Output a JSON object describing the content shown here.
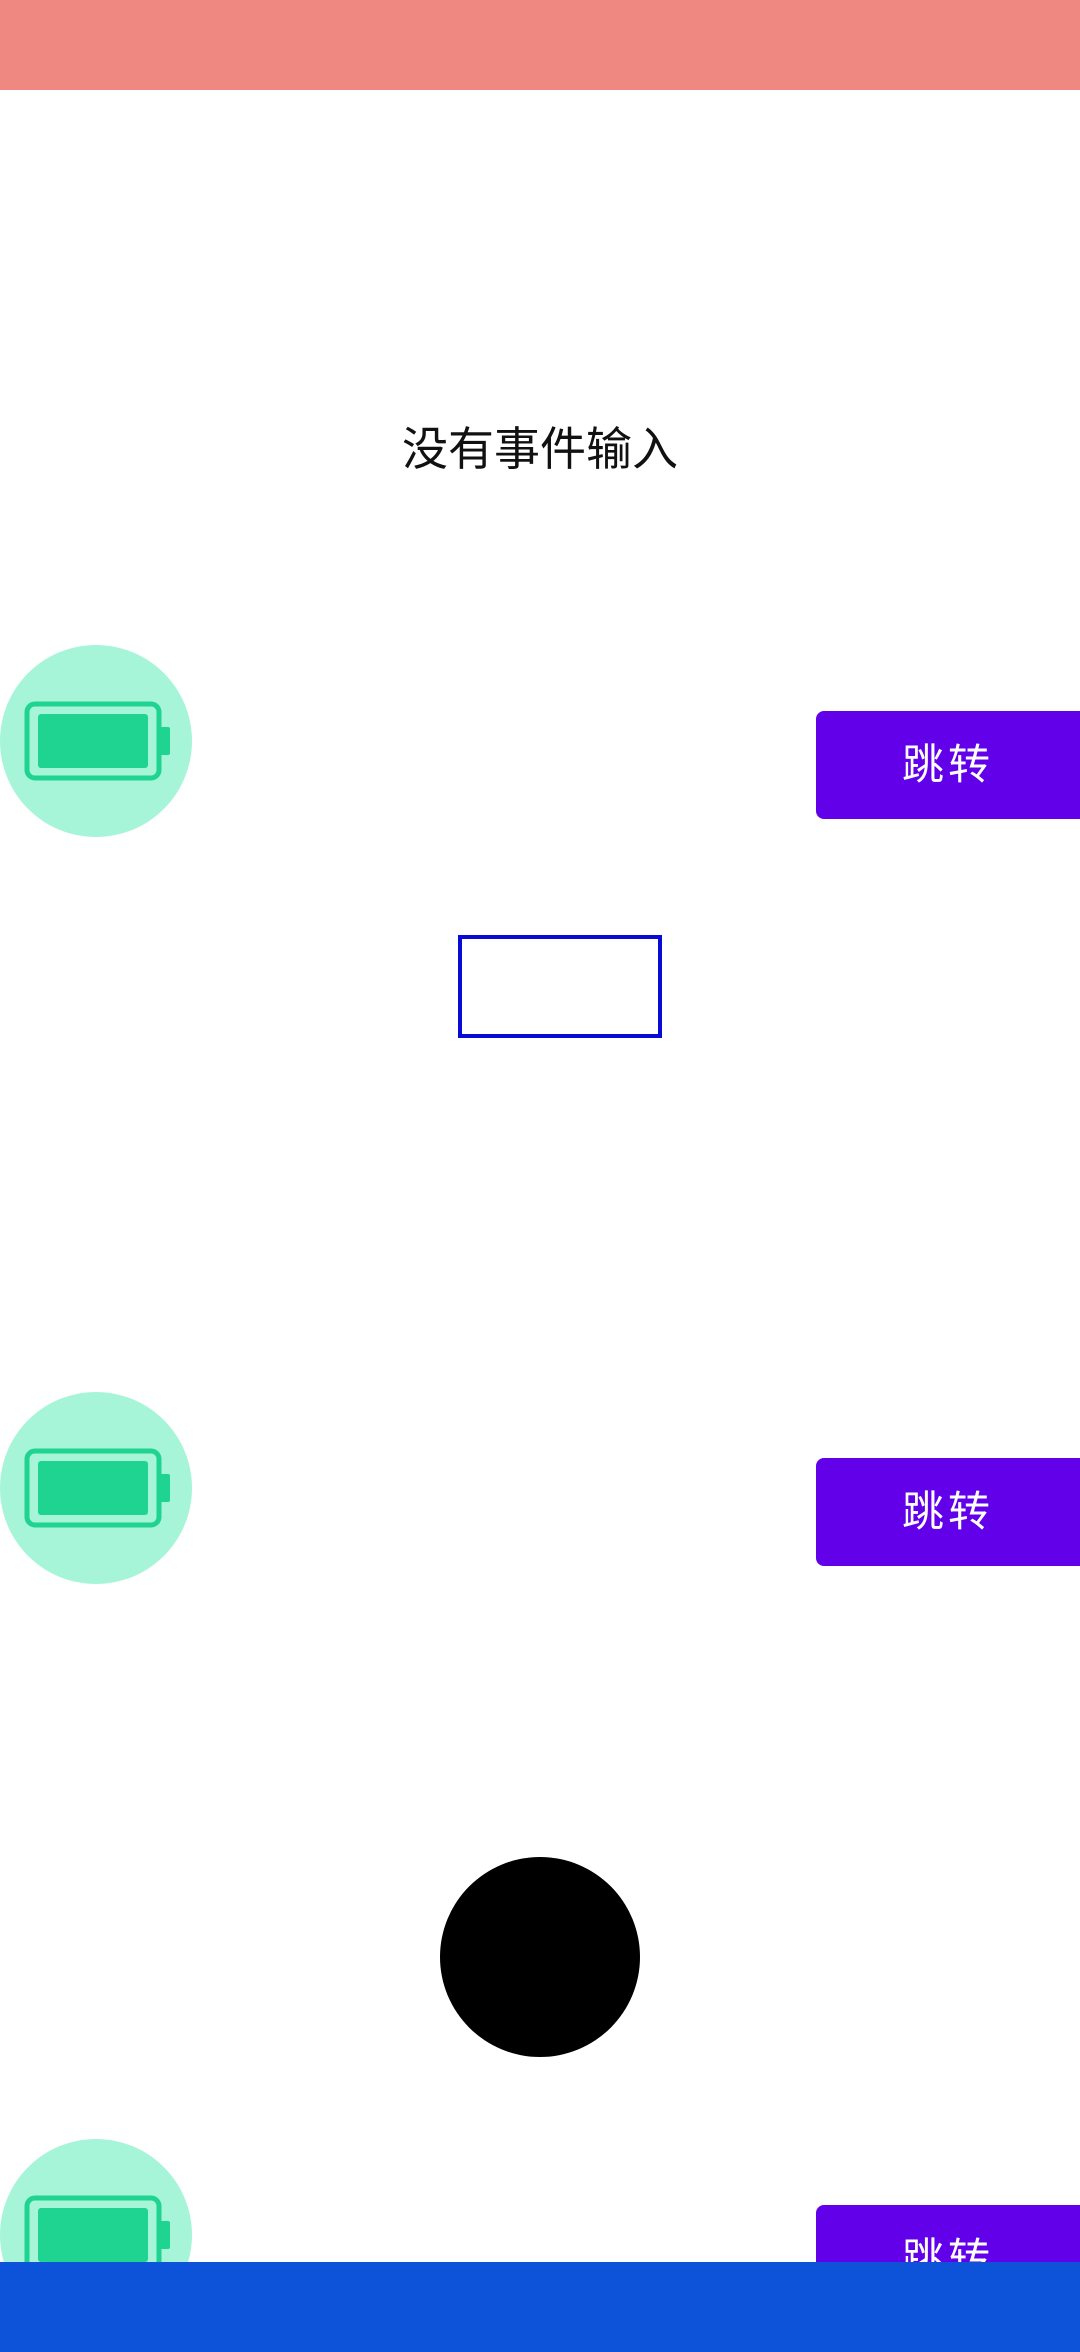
{
  "status": {
    "text": "没有事件输入"
  },
  "rows": [
    {
      "icon": "battery-full-icon",
      "button_label": "跳转"
    },
    {
      "icon": "battery-full-icon",
      "button_label": "跳转"
    },
    {
      "icon": "battery-full-icon",
      "button_label": "跳转"
    }
  ],
  "colors": {
    "top_bar": "#ef8880",
    "bottom_bar": "#0d53da",
    "button": "#6200ea",
    "battery_bg": "#a6f5d9",
    "battery_fill": "#1fd491",
    "input_border": "#0a0ad6"
  }
}
